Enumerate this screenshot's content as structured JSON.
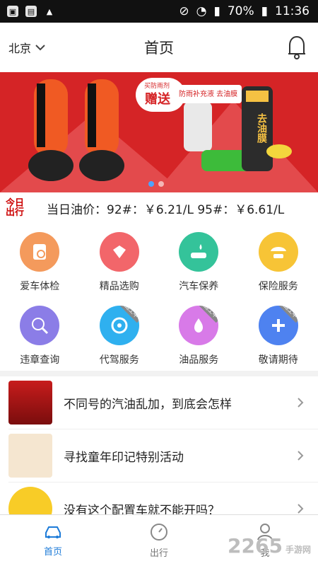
{
  "status": {
    "battery": "70%",
    "time": "11:36"
  },
  "header": {
    "city": "北京",
    "title": "首页"
  },
  "banner": {
    "promo_tag": "买防雨剂",
    "promo_big": "赠送",
    "promo_sub": "防雨补充液 去油膜",
    "bottle_text": "去油膜"
  },
  "oil": {
    "logo_line1": "今日",
    "logo_line2": "出行",
    "price": "当日油价：92#：￥6.21/L  95#：￥6.61/L"
  },
  "services": [
    {
      "label": "爱车体检",
      "color": "#f49a5c"
    },
    {
      "label": "精品选购",
      "color": "#f2666a"
    },
    {
      "label": "汽车保养",
      "color": "#34c39a"
    },
    {
      "label": "保险服务",
      "color": "#f7c436"
    },
    {
      "label": "违章查询",
      "color": "#8b7de7"
    },
    {
      "label": "代驾服务",
      "color": "#2fb0ef"
    },
    {
      "label": "油品服务",
      "color": "#d87ae8"
    },
    {
      "label": "敬请期待",
      "color": "#4e82f0"
    }
  ],
  "badge_text": "施工中",
  "news": [
    {
      "title": "不同号的汽油乱加，到底会怎样"
    },
    {
      "title": "寻找童年印记特别活动"
    },
    {
      "title": "没有这个配置车就不能开吗？"
    }
  ],
  "tabs": [
    {
      "label": "首页"
    },
    {
      "label": "出行"
    },
    {
      "label": "我"
    }
  ],
  "watermark": "2265",
  "watermark_site": "手游网"
}
